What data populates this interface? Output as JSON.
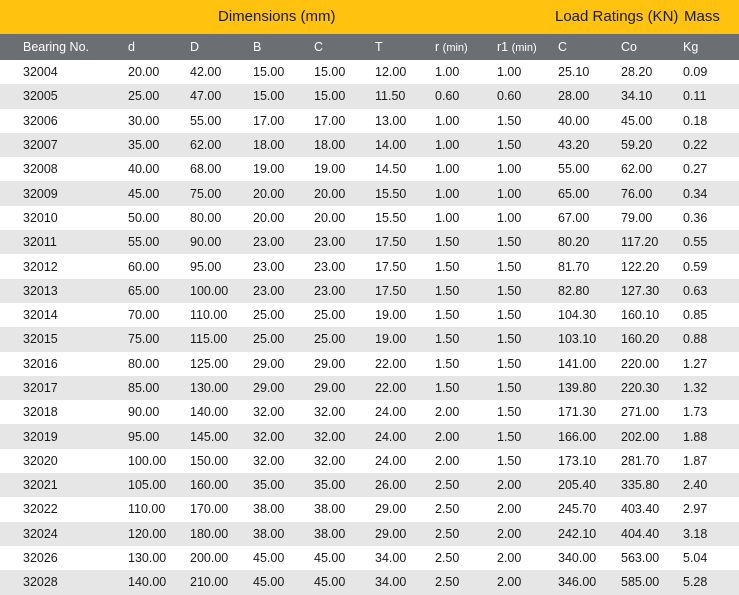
{
  "band": {
    "dimensions": "Dimensions (mm)",
    "load_ratings": "Load Ratings (KN)",
    "mass": "Mass"
  },
  "columns": [
    "Bearing No.",
    "d",
    "D",
    "B",
    "C",
    "T",
    "r",
    "(min)",
    "r1",
    "(min)",
    "C",
    "Co",
    "Kg"
  ],
  "rows": [
    [
      "32004",
      "20.00",
      "42.00",
      "15.00",
      "15.00",
      "12.00",
      "1.00",
      "1.00",
      "25.10",
      "28.20",
      "0.09"
    ],
    [
      "32005",
      "25.00",
      "47.00",
      "15.00",
      "15.00",
      "11.50",
      "0.60",
      "0.60",
      "28.00",
      "34.10",
      "0.11"
    ],
    [
      "32006",
      "30.00",
      "55.00",
      "17.00",
      "17.00",
      "13.00",
      "1.00",
      "1.50",
      "40.00",
      "45.00",
      "0.18"
    ],
    [
      "32007",
      "35.00",
      "62.00",
      "18.00",
      "18.00",
      "14.00",
      "1.00",
      "1.50",
      "43.20",
      "59.20",
      "0.22"
    ],
    [
      "32008",
      "40.00",
      "68.00",
      "19.00",
      "19.00",
      "14.50",
      "1.00",
      "1.00",
      "55.00",
      "62.00",
      "0.27"
    ],
    [
      "32009",
      "45.00",
      "75.00",
      "20.00",
      "20.00",
      "15.50",
      "1.00",
      "1.00",
      "65.00",
      "76.00",
      "0.34"
    ],
    [
      "32010",
      "50.00",
      "80.00",
      "20.00",
      "20.00",
      "15.50",
      "1.00",
      "1.00",
      "67.00",
      "79.00",
      "0.36"
    ],
    [
      "32011",
      "55.00",
      "90.00",
      "23.00",
      "23.00",
      "17.50",
      "1.50",
      "1.50",
      "80.20",
      "117.20",
      "0.55"
    ],
    [
      "32012",
      "60.00",
      "95.00",
      "23.00",
      "23.00",
      "17.50",
      "1.50",
      "1.50",
      "81.70",
      "122.20",
      "0.59"
    ],
    [
      "32013",
      "65.00",
      "100.00",
      "23.00",
      "23.00",
      "17.50",
      "1.50",
      "1.50",
      "82.80",
      "127.30",
      "0.63"
    ],
    [
      "32014",
      "70.00",
      "110.00",
      "25.00",
      "25.00",
      "19.00",
      "1.50",
      "1.50",
      "104.30",
      "160.10",
      "0.85"
    ],
    [
      "32015",
      "75.00",
      "115.00",
      "25.00",
      "25.00",
      "19.00",
      "1.50",
      "1.50",
      "103.10",
      "160.20",
      "0.88"
    ],
    [
      "32016",
      "80.00",
      "125.00",
      "29.00",
      "29.00",
      "22.00",
      "1.50",
      "1.50",
      "141.00",
      "220.00",
      "1.27"
    ],
    [
      "32017",
      "85.00",
      "130.00",
      "29.00",
      "29.00",
      "22.00",
      "1.50",
      "1.50",
      "139.80",
      "220.30",
      "1.32"
    ],
    [
      "32018",
      "90.00",
      "140.00",
      "32.00",
      "32.00",
      "24.00",
      "2.00",
      "1.50",
      "171.30",
      "271.00",
      "1.73"
    ],
    [
      "32019",
      "95.00",
      "145.00",
      "32.00",
      "32.00",
      "24.00",
      "2.00",
      "1.50",
      "166.00",
      "202.00",
      "1.88"
    ],
    [
      "32020",
      "100.00",
      "150.00",
      "32.00",
      "32.00",
      "24.00",
      "2.00",
      "1.50",
      "173.10",
      "281.70",
      "1.87"
    ],
    [
      "32021",
      "105.00",
      "160.00",
      "35.00",
      "35.00",
      "26.00",
      "2.50",
      "2.00",
      "205.40",
      "335.80",
      "2.40"
    ],
    [
      "32022",
      "110.00",
      "170.00",
      "38.00",
      "38.00",
      "29.00",
      "2.50",
      "2.00",
      "245.70",
      "403.40",
      "2.97"
    ],
    [
      "32024",
      "120.00",
      "180.00",
      "38.00",
      "38.00",
      "29.00",
      "2.50",
      "2.00",
      "242.10",
      "404.40",
      "3.18"
    ],
    [
      "32026",
      "130.00",
      "200.00",
      "45.00",
      "45.00",
      "34.00",
      "2.50",
      "2.00",
      "340.00",
      "563.00",
      "5.04"
    ],
    [
      "32028",
      "140.00",
      "210.00",
      "45.00",
      "45.00",
      "34.00",
      "2.50",
      "2.00",
      "346.00",
      "585.00",
      "5.28"
    ]
  ]
}
